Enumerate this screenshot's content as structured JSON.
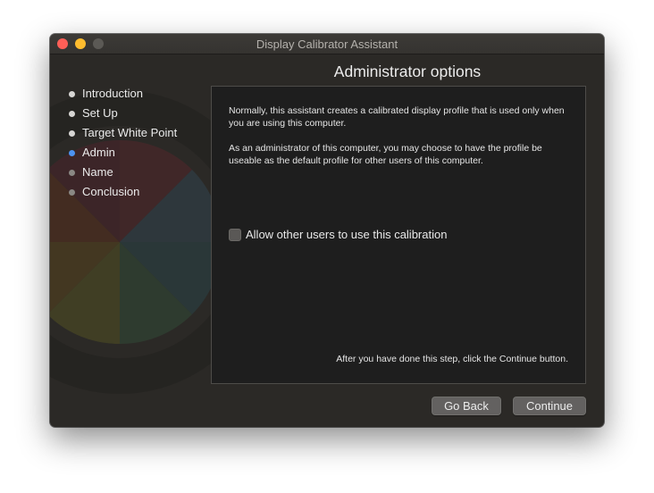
{
  "window": {
    "title": "Display Calibrator Assistant",
    "heading": "Administrator options"
  },
  "steps": [
    {
      "label": "Introduction",
      "state": "done"
    },
    {
      "label": "Set Up",
      "state": "done"
    },
    {
      "label": "Target White Point",
      "state": "done"
    },
    {
      "label": "Admin",
      "state": "current"
    },
    {
      "label": "Name",
      "state": "pending"
    },
    {
      "label": "Conclusion",
      "state": "pending"
    }
  ],
  "panel": {
    "paragraph1": "Normally, this assistant creates a calibrated display profile that is used only when you are using this computer.",
    "paragraph2": "As an administrator of this computer, you may choose to have the profile be useable as the default profile for other users of this computer.",
    "checkbox": {
      "label": "Allow other users to use this calibration",
      "checked": false
    },
    "footer": "After you have done this step, click the Continue button."
  },
  "buttons": {
    "back": "Go Back",
    "continue": "Continue"
  },
  "colors": {
    "close": "#fe5f57",
    "minimize": "#febc2e",
    "zoom_disabled": "#5b5955",
    "current_step": "#4d92f2"
  }
}
